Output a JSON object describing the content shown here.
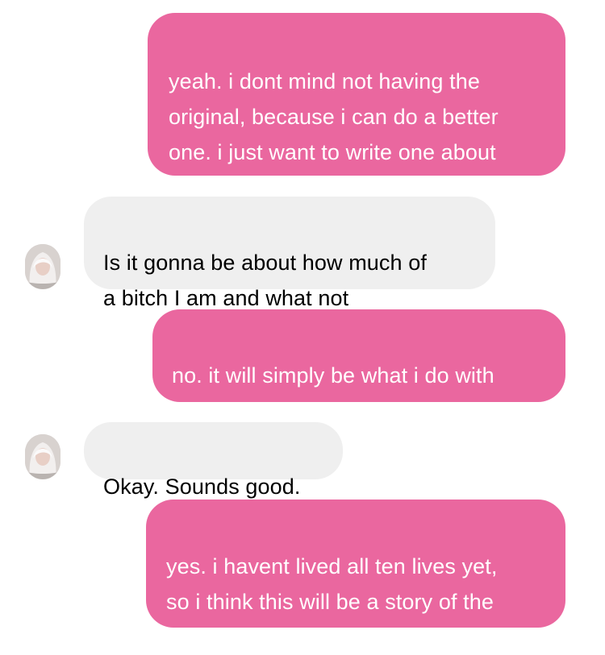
{
  "messages": [
    {
      "side": "outgoing",
      "text": "yeah. i dont mind not having the\noriginal, because i can do a better\none. i just want to write one about\nyou."
    },
    {
      "side": "incoming",
      "text": "Is it gonna be about how much of\na bitch I am and what not"
    },
    {
      "side": "outgoing",
      "text": "no. it will simply be what i do with\nmy feelings for you, i suppose"
    },
    {
      "side": "incoming",
      "text": "Okay. Sounds good."
    },
    {
      "side": "outgoing",
      "text": "yes. i havent lived all ten lives yet,\nso i think this will be a story of the\nother nine."
    }
  ],
  "colors": {
    "outgoing_bubble": "#ea679f",
    "incoming_bubble": "#efefef",
    "outgoing_text": "#ffffff",
    "incoming_text": "#000000"
  }
}
